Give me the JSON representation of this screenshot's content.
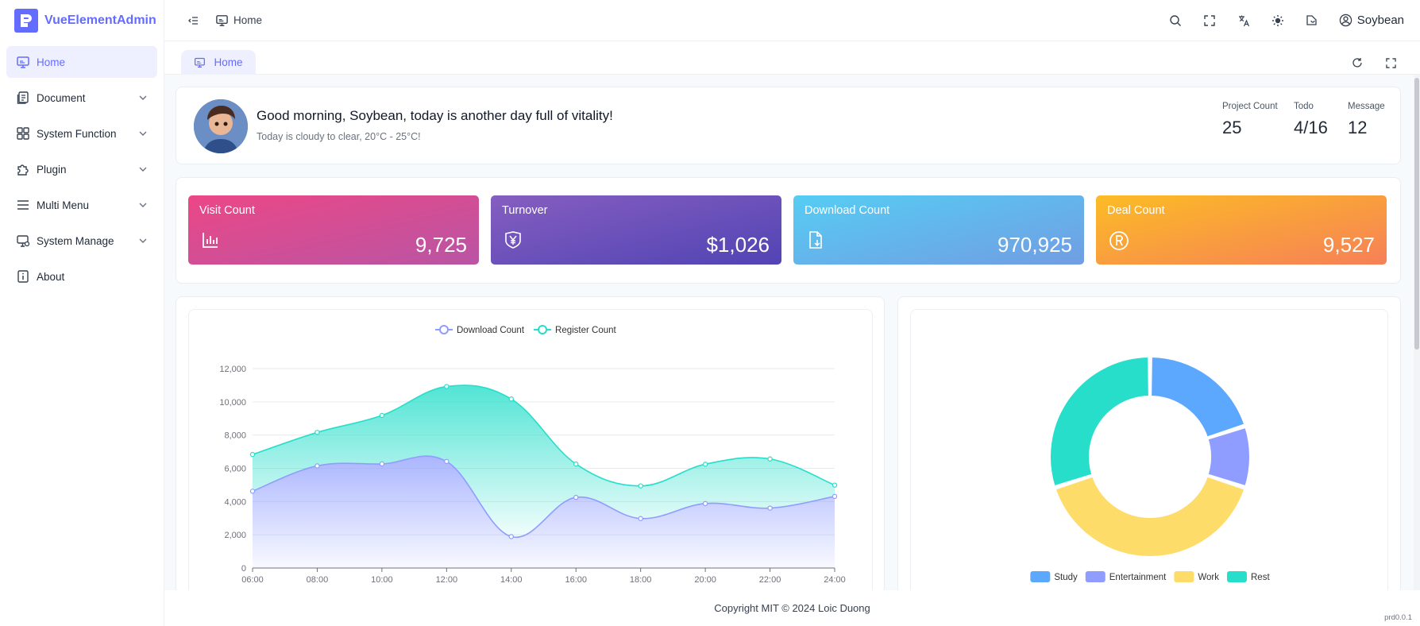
{
  "app": {
    "name": "VueElementAdmin"
  },
  "sidebar": {
    "items": [
      {
        "label": "Home",
        "icon": "monitor-icon",
        "active": true
      },
      {
        "label": "Document",
        "icon": "document-icon",
        "expandable": true
      },
      {
        "label": "System Function",
        "icon": "grid-icon",
        "expandable": true
      },
      {
        "label": "Plugin",
        "icon": "puzzle-icon",
        "expandable": true
      },
      {
        "label": "Multi Menu",
        "icon": "menu-icon",
        "expandable": true
      },
      {
        "label": "System Manage",
        "icon": "monitor-settings-icon",
        "expandable": true
      },
      {
        "label": "About",
        "icon": "info-icon"
      }
    ]
  },
  "header": {
    "breadcrumb": "Home",
    "user": "Soybean",
    "icons": [
      "search-icon",
      "fullscreen-icon",
      "translate-icon",
      "sun-icon",
      "theme-icon",
      "user-circle-icon"
    ]
  },
  "tabs": {
    "active": "Home"
  },
  "greeting": {
    "title": "Good morning, Soybean, today is another day full of vitality!",
    "subtitle": "Today is cloudy to clear, 20°C - 25°C!",
    "stats": [
      {
        "label": "Project Count",
        "value": "25"
      },
      {
        "label": "Todo",
        "value": "4/16"
      },
      {
        "label": "Message",
        "value": "12"
      }
    ]
  },
  "kpis": [
    {
      "title": "Visit Count",
      "value": "9,725",
      "icon": "bar-chart-icon",
      "colors": [
        "#ec4786",
        "#b955a4"
      ]
    },
    {
      "title": "Turnover",
      "value": "$1,026",
      "icon": "yen-icon",
      "colors": [
        "#865ec0",
        "#5144b4"
      ]
    },
    {
      "title": "Download Count",
      "value": "970,925",
      "icon": "download-file-icon",
      "colors": [
        "#56cdf3",
        "#719de3"
      ]
    },
    {
      "title": "Deal Count",
      "value": "9,527",
      "icon": "registered-icon",
      "colors": [
        "#fcbc25",
        "#f68057"
      ]
    }
  ],
  "chart_data": [
    {
      "type": "area",
      "x": [
        "06:00",
        "08:00",
        "10:00",
        "12:00",
        "14:00",
        "16:00",
        "18:00",
        "20:00",
        "22:00",
        "24:00"
      ],
      "ylim": [
        0,
        12000
      ],
      "yticks": [
        "0",
        "2,000",
        "4,000",
        "6,000",
        "8,000",
        "10,000",
        "12,000"
      ],
      "legend_position": "top-center",
      "grid": true,
      "series": [
        {
          "name": "Download Count",
          "color": "#8e9dff",
          "values": [
            4623,
            6145,
            6268,
            6411,
            1890,
            4251,
            2978,
            3880,
            3606,
            4311
          ]
        },
        {
          "name": "Register Count",
          "color": "#26deca",
          "values": [
            2208,
            2016,
            2916,
            4512,
            8281,
            2008,
            1963,
            2367,
            2956,
            678
          ]
        }
      ]
    },
    {
      "type": "pie",
      "donut": true,
      "legend_position": "bottom",
      "categories": [
        "Study",
        "Entertainment",
        "Work",
        "Rest"
      ],
      "values": [
        20,
        10,
        40,
        30
      ],
      "colors": [
        "#5da8ff",
        "#8e9dff",
        "#fedc69",
        "#26deca"
      ]
    }
  ],
  "footer": {
    "copyright": "Copyright MIT © 2024 Loic Duong",
    "version": "prd0.0.1"
  }
}
